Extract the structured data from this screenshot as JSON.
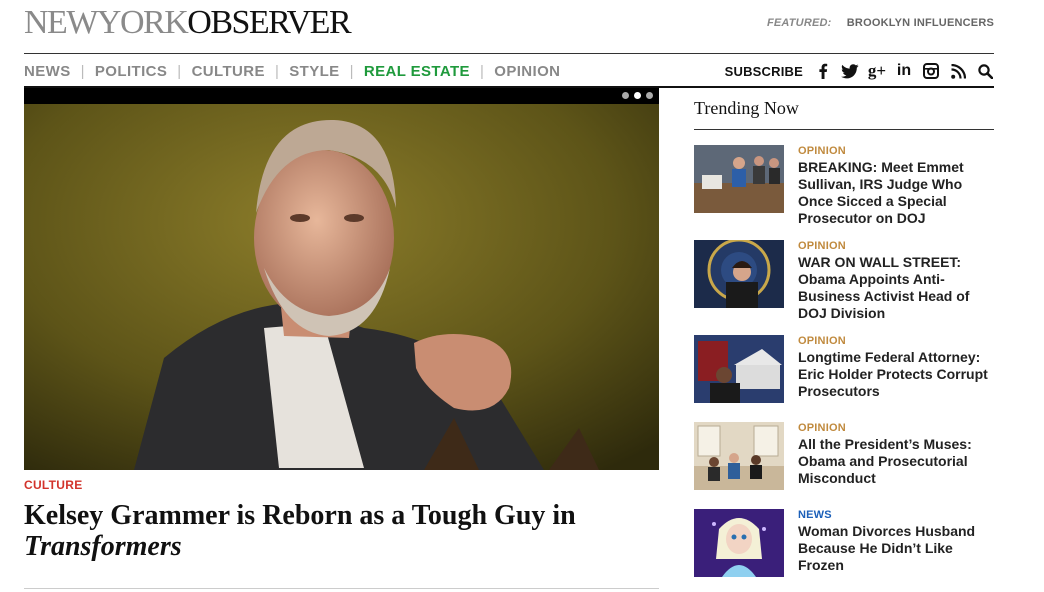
{
  "masthead": {
    "logo_part1": "NEWYORK",
    "logo_part2": "OBSERVER",
    "featured_label": "FEATURED:",
    "featured_link": "BROOKLYN INFLUENCERS"
  },
  "nav": {
    "items": [
      {
        "label": "NEWS"
      },
      {
        "label": "POLITICS"
      },
      {
        "label": "CULTURE"
      },
      {
        "label": "STYLE"
      },
      {
        "label": "REAL ESTATE"
      },
      {
        "label": "OPINION"
      }
    ],
    "active": "REAL ESTATE",
    "subscribe": "SUBSCRIBE",
    "social_icons": [
      "facebook-icon",
      "twitter-icon",
      "google-plus-icon",
      "linkedin-icon",
      "instagram-icon",
      "rss-icon",
      "search-icon"
    ]
  },
  "hero": {
    "kicker": "CULTURE",
    "headline_part1": "Kelsey Grammer is Reborn as a Tough Guy in ",
    "headline_italic": "Transformers",
    "slider_dots": 3,
    "active_dot": 2
  },
  "trending": {
    "title": "Trending Now",
    "stories": [
      {
        "category": "OPINION",
        "title": "BREAKING: Meet Emmet Sullivan, IRS Judge Who Once Sicced a Special Prosecutor on DOJ"
      },
      {
        "category": "OPINION",
        "title": "WAR ON WALL STREET: Obama Appoints Anti-Business Activist Head of DOJ Division"
      },
      {
        "category": "OPINION",
        "title": "Longtime Federal Attorney: Eric Holder Protects Corrupt Prosecutors"
      },
      {
        "category": "OPINION",
        "title": "All the President’s Muses: Obama and Prosecutorial Misconduct"
      },
      {
        "category": "NEWS",
        "title": "Woman Divorces Husband Because He Didn’t Like Frozen"
      }
    ]
  },
  "colors": {
    "accent_green": "#1f9a3c",
    "kicker_red": "#d2332b",
    "opinion_gold": "#c08a3e",
    "news_blue": "#1b5fb8"
  }
}
